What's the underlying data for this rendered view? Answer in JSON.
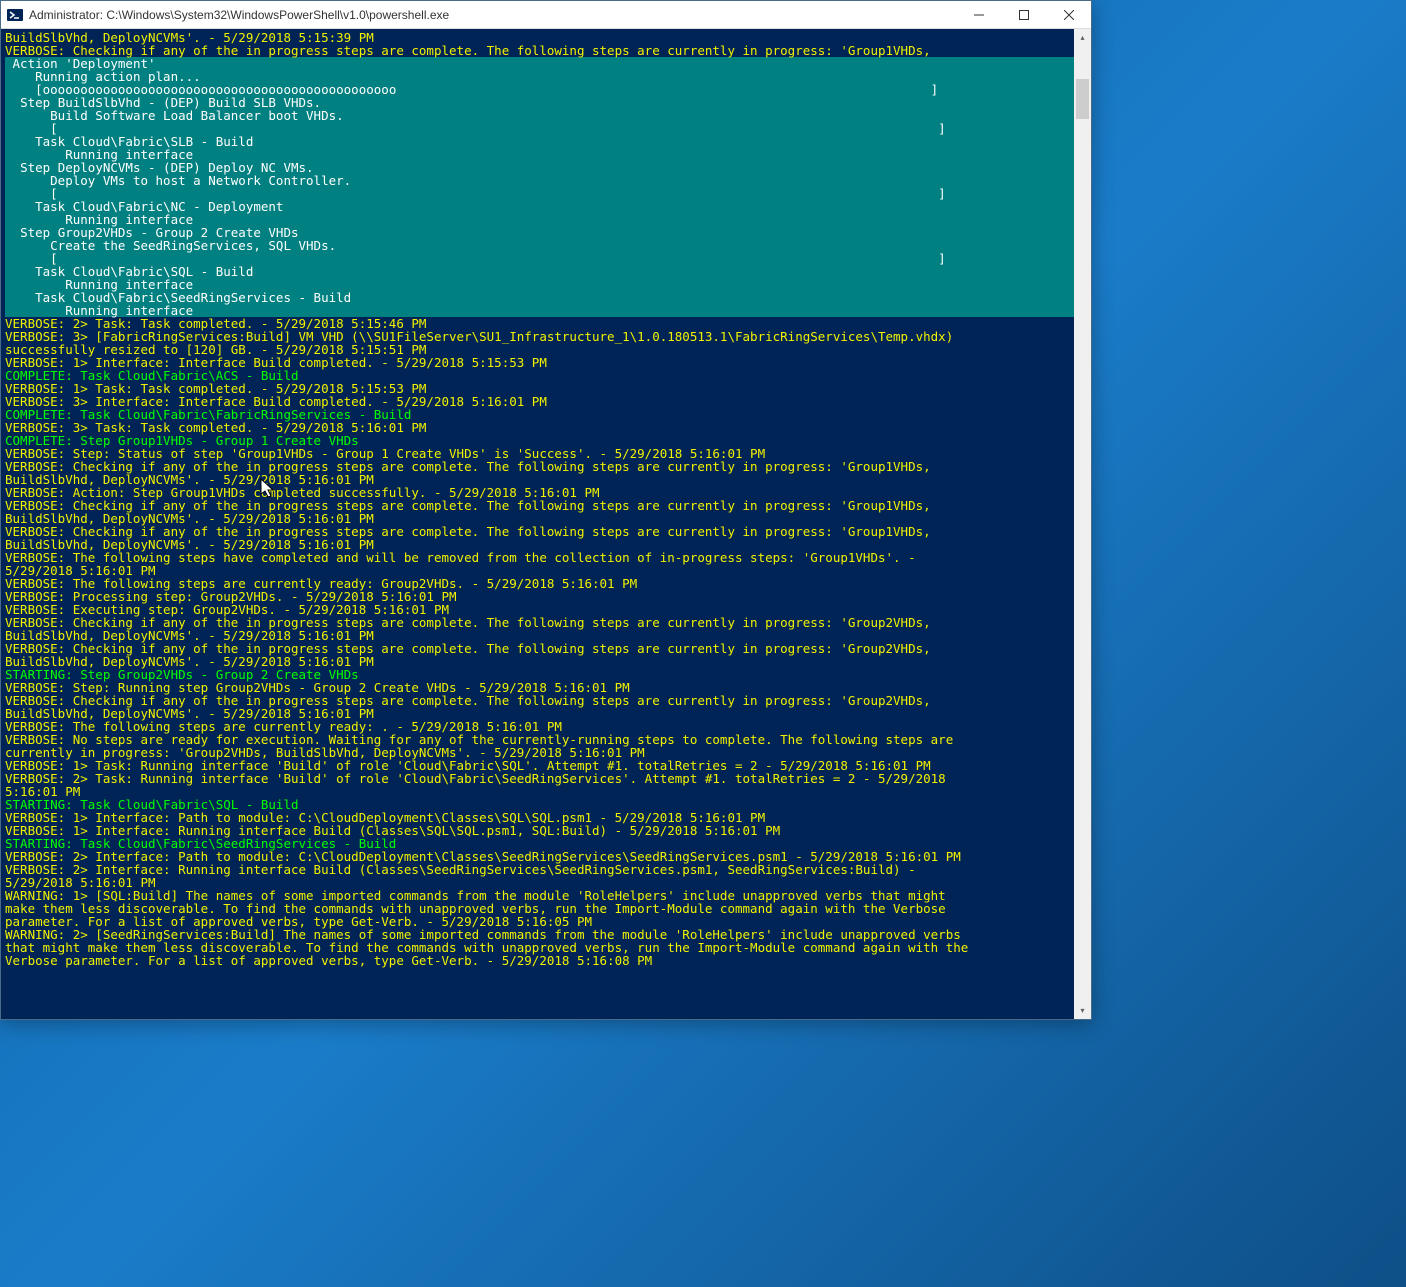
{
  "window": {
    "title": "Administrator: C:\\Windows\\System32\\WindowsPowerShell\\v1.0\\powershell.exe"
  },
  "lines": [
    {
      "cls": "yellow",
      "txt": "BuildSlbVhd, DeployNCVMs'. - 5/29/2018 5:15:39 PM"
    },
    {
      "cls": "yellow",
      "txt": "VERBOSE: Checking if any of the in progress steps are complete. The following steps are currently in progress: 'Group1VHDs,"
    },
    {
      "cls": "teal-bg",
      "txt": ""
    },
    {
      "cls": "teal-bg",
      "txt": " Action 'Deployment'"
    },
    {
      "cls": "teal-bg",
      "txt": "    Running action plan..."
    },
    {
      "cls": "teal-bg",
      "txt": "    [ooooooooooooooooooooooooooooooooooooooooooooooo                                                                       ]"
    },
    {
      "cls": "teal-bg",
      "txt": "  Step BuildSlbVhd - (DEP) Build SLB VHDs."
    },
    {
      "cls": "teal-bg",
      "txt": "      Build Software Load Balancer boot VHDs."
    },
    {
      "cls": "teal-bg",
      "txt": "      [                                                                                                                     ]"
    },
    {
      "cls": "teal-bg",
      "txt": "    Task Cloud\\Fabric\\SLB - Build"
    },
    {
      "cls": "teal-bg",
      "txt": "        Running interface"
    },
    {
      "cls": "teal-bg",
      "txt": "  Step DeployNCVMs - (DEP) Deploy NC VMs."
    },
    {
      "cls": "teal-bg",
      "txt": "      Deploy VMs to host a Network Controller."
    },
    {
      "cls": "teal-bg",
      "txt": "      [                                                                                                                     ]"
    },
    {
      "cls": "teal-bg",
      "txt": "    Task Cloud\\Fabric\\NC - Deployment"
    },
    {
      "cls": "teal-bg",
      "txt": "        Running interface"
    },
    {
      "cls": "teal-bg",
      "txt": "  Step Group2VHDs - Group 2 Create VHDs"
    },
    {
      "cls": "teal-bg",
      "txt": "      Create the SeedRingServices, SQL VHDs."
    },
    {
      "cls": "teal-bg",
      "txt": "      [                                                                                                                     ]"
    },
    {
      "cls": "teal-bg",
      "txt": "    Task Cloud\\Fabric\\SQL - Build"
    },
    {
      "cls": "teal-bg",
      "txt": "        Running interface"
    },
    {
      "cls": "teal-bg",
      "txt": "    Task Cloud\\Fabric\\SeedRingServices - Build"
    },
    {
      "cls": "teal-bg",
      "txt": "        Running interface"
    },
    {
      "cls": "teal-bg",
      "txt": ""
    },
    {
      "cls": "yellow",
      "txt": "VERBOSE: 2> Task: Task completed. - 5/29/2018 5:15:46 PM"
    },
    {
      "cls": "yellow",
      "txt": "VERBOSE: 3> [FabricRingServices:Build] VM VHD (\\\\SU1FileServer\\SU1_Infrastructure_1\\1.0.180513.1\\FabricRingServices\\Temp.vhdx) "
    },
    {
      "cls": "yellow",
      "txt": "successfully resized to [120] GB. - 5/29/2018 5:15:51 PM"
    },
    {
      "cls": "yellow",
      "txt": "VERBOSE: 1> Interface: Interface Build completed. - 5/29/2018 5:15:53 PM"
    },
    {
      "cls": "green",
      "txt": "COMPLETE: Task Cloud\\Fabric\\ACS - Build"
    },
    {
      "cls": "yellow",
      "txt": "VERBOSE: 1> Task: Task completed. - 5/29/2018 5:15:53 PM"
    },
    {
      "cls": "yellow",
      "txt": "VERBOSE: 3> Interface: Interface Build completed. - 5/29/2018 5:16:01 PM"
    },
    {
      "cls": "green",
      "txt": "COMPLETE: Task Cloud\\Fabric\\FabricRingServices - Build"
    },
    {
      "cls": "yellow",
      "txt": "VERBOSE: 3> Task: Task completed. - 5/29/2018 5:16:01 PM"
    },
    {
      "cls": "green",
      "txt": "COMPLETE: Step Group1VHDs - Group 1 Create VHDs"
    },
    {
      "cls": "yellow",
      "txt": "VERBOSE: Step: Status of step 'Group1VHDs - Group 1 Create VHDs' is 'Success'. - 5/29/2018 5:16:01 PM"
    },
    {
      "cls": "yellow",
      "txt": "VERBOSE: Checking if any of the in progress steps are complete. The following steps are currently in progress: 'Group1VHDs, "
    },
    {
      "cls": "yellow",
      "txt": "BuildSlbVhd, DeployNCVMs'. - 5/29/2018 5:16:01 PM"
    },
    {
      "cls": "yellow",
      "txt": "VERBOSE: Action: Step Group1VHDs completed successfully. - 5/29/2018 5:16:01 PM"
    },
    {
      "cls": "yellow",
      "txt": "VERBOSE: Checking if any of the in progress steps are complete. The following steps are currently in progress: 'Group1VHDs, "
    },
    {
      "cls": "yellow",
      "txt": "BuildSlbVhd, DeployNCVMs'. - 5/29/2018 5:16:01 PM"
    },
    {
      "cls": "yellow",
      "txt": "VERBOSE: Checking if any of the in progress steps are complete. The following steps are currently in progress: 'Group1VHDs, "
    },
    {
      "cls": "yellow",
      "txt": "BuildSlbVhd, DeployNCVMs'. - 5/29/2018 5:16:01 PM"
    },
    {
      "cls": "yellow",
      "txt": "VERBOSE: The following steps have completed and will be removed from the collection of in-progress steps: 'Group1VHDs'. - "
    },
    {
      "cls": "yellow",
      "txt": "5/29/2018 5:16:01 PM"
    },
    {
      "cls": "yellow",
      "txt": "VERBOSE: The following steps are currently ready: Group2VHDs. - 5/29/2018 5:16:01 PM"
    },
    {
      "cls": "yellow",
      "txt": "VERBOSE: Processing step: Group2VHDs. - 5/29/2018 5:16:01 PM"
    },
    {
      "cls": "yellow",
      "txt": "VERBOSE: Executing step: Group2VHDs. - 5/29/2018 5:16:01 PM"
    },
    {
      "cls": "yellow",
      "txt": "VERBOSE: Checking if any of the in progress steps are complete. The following steps are currently in progress: 'Group2VHDs, "
    },
    {
      "cls": "yellow",
      "txt": "BuildSlbVhd, DeployNCVMs'. - 5/29/2018 5:16:01 PM"
    },
    {
      "cls": "yellow",
      "txt": "VERBOSE: Checking if any of the in progress steps are complete. The following steps are currently in progress: 'Group2VHDs, "
    },
    {
      "cls": "yellow",
      "txt": "BuildSlbVhd, DeployNCVMs'. - 5/29/2018 5:16:01 PM"
    },
    {
      "cls": "green",
      "txt": "STARTING: Step Group2VHDs - Group 2 Create VHDs"
    },
    {
      "cls": "yellow",
      "txt": "VERBOSE: Step: Running step Group2VHDs - Group 2 Create VHDs - 5/29/2018 5:16:01 PM"
    },
    {
      "cls": "yellow",
      "txt": "VERBOSE: Checking if any of the in progress steps are complete. The following steps are currently in progress: 'Group2VHDs, "
    },
    {
      "cls": "yellow",
      "txt": "BuildSlbVhd, DeployNCVMs'. - 5/29/2018 5:16:01 PM"
    },
    {
      "cls": "yellow",
      "txt": "VERBOSE: The following steps are currently ready: . - 5/29/2018 5:16:01 PM"
    },
    {
      "cls": "yellow",
      "txt": "VERBOSE: No steps are ready for execution. Waiting for any of the currently-running steps to complete. The following steps are "
    },
    {
      "cls": "yellow",
      "txt": "currently in progress: 'Group2VHDs, BuildSlbVhd, DeployNCVMs'. - 5/29/2018 5:16:01 PM"
    },
    {
      "cls": "yellow",
      "txt": "VERBOSE: 1> Task: Running interface 'Build' of role 'Cloud\\Fabric\\SQL'. Attempt #1. totalRetries = 2 - 5/29/2018 5:16:01 PM"
    },
    {
      "cls": "yellow",
      "txt": "VERBOSE: 2> Task: Running interface 'Build' of role 'Cloud\\Fabric\\SeedRingServices'. Attempt #1. totalRetries = 2 - 5/29/2018 "
    },
    {
      "cls": "yellow",
      "txt": "5:16:01 PM"
    },
    {
      "cls": "green",
      "txt": "STARTING: Task Cloud\\Fabric\\SQL - Build"
    },
    {
      "cls": "yellow",
      "txt": "VERBOSE: 1> Interface: Path to module: C:\\CloudDeployment\\Classes\\SQL\\SQL.psm1 - 5/29/2018 5:16:01 PM"
    },
    {
      "cls": "yellow",
      "txt": "VERBOSE: 1> Interface: Running interface Build (Classes\\SQL\\SQL.psm1, SQL:Build) - 5/29/2018 5:16:01 PM"
    },
    {
      "cls": "green",
      "txt": "STARTING: Task Cloud\\Fabric\\SeedRingServices - Build"
    },
    {
      "cls": "yellow",
      "txt": "VERBOSE: 2> Interface: Path to module: C:\\CloudDeployment\\Classes\\SeedRingServices\\SeedRingServices.psm1 - 5/29/2018 5:16:01 PM"
    },
    {
      "cls": "yellow",
      "txt": "VERBOSE: 2> Interface: Running interface Build (Classes\\SeedRingServices\\SeedRingServices.psm1, SeedRingServices:Build) - "
    },
    {
      "cls": "yellow",
      "txt": "5/29/2018 5:16:01 PM"
    },
    {
      "cls": "yellow",
      "txt": "WARNING: 1> [SQL:Build] The names of some imported commands from the module 'RoleHelpers' include unapproved verbs that might "
    },
    {
      "cls": "yellow",
      "txt": "make them less discoverable. To find the commands with unapproved verbs, run the Import-Module command again with the Verbose "
    },
    {
      "cls": "yellow",
      "txt": "parameter. For a list of approved verbs, type Get-Verb. - 5/29/2018 5:16:05 PM"
    },
    {
      "cls": "yellow",
      "txt": "WARNING: 2> [SeedRingServices:Build] The names of some imported commands from the module 'RoleHelpers' include unapproved verbs "
    },
    {
      "cls": "yellow",
      "txt": "that might make them less discoverable. To find the commands with unapproved verbs, run the Import-Module command again with the"
    },
    {
      "cls": "yellow",
      "txt": "Verbose parameter. For a list of approved verbs, type Get-Verb. - 5/29/2018 5:16:08 PM"
    }
  ]
}
